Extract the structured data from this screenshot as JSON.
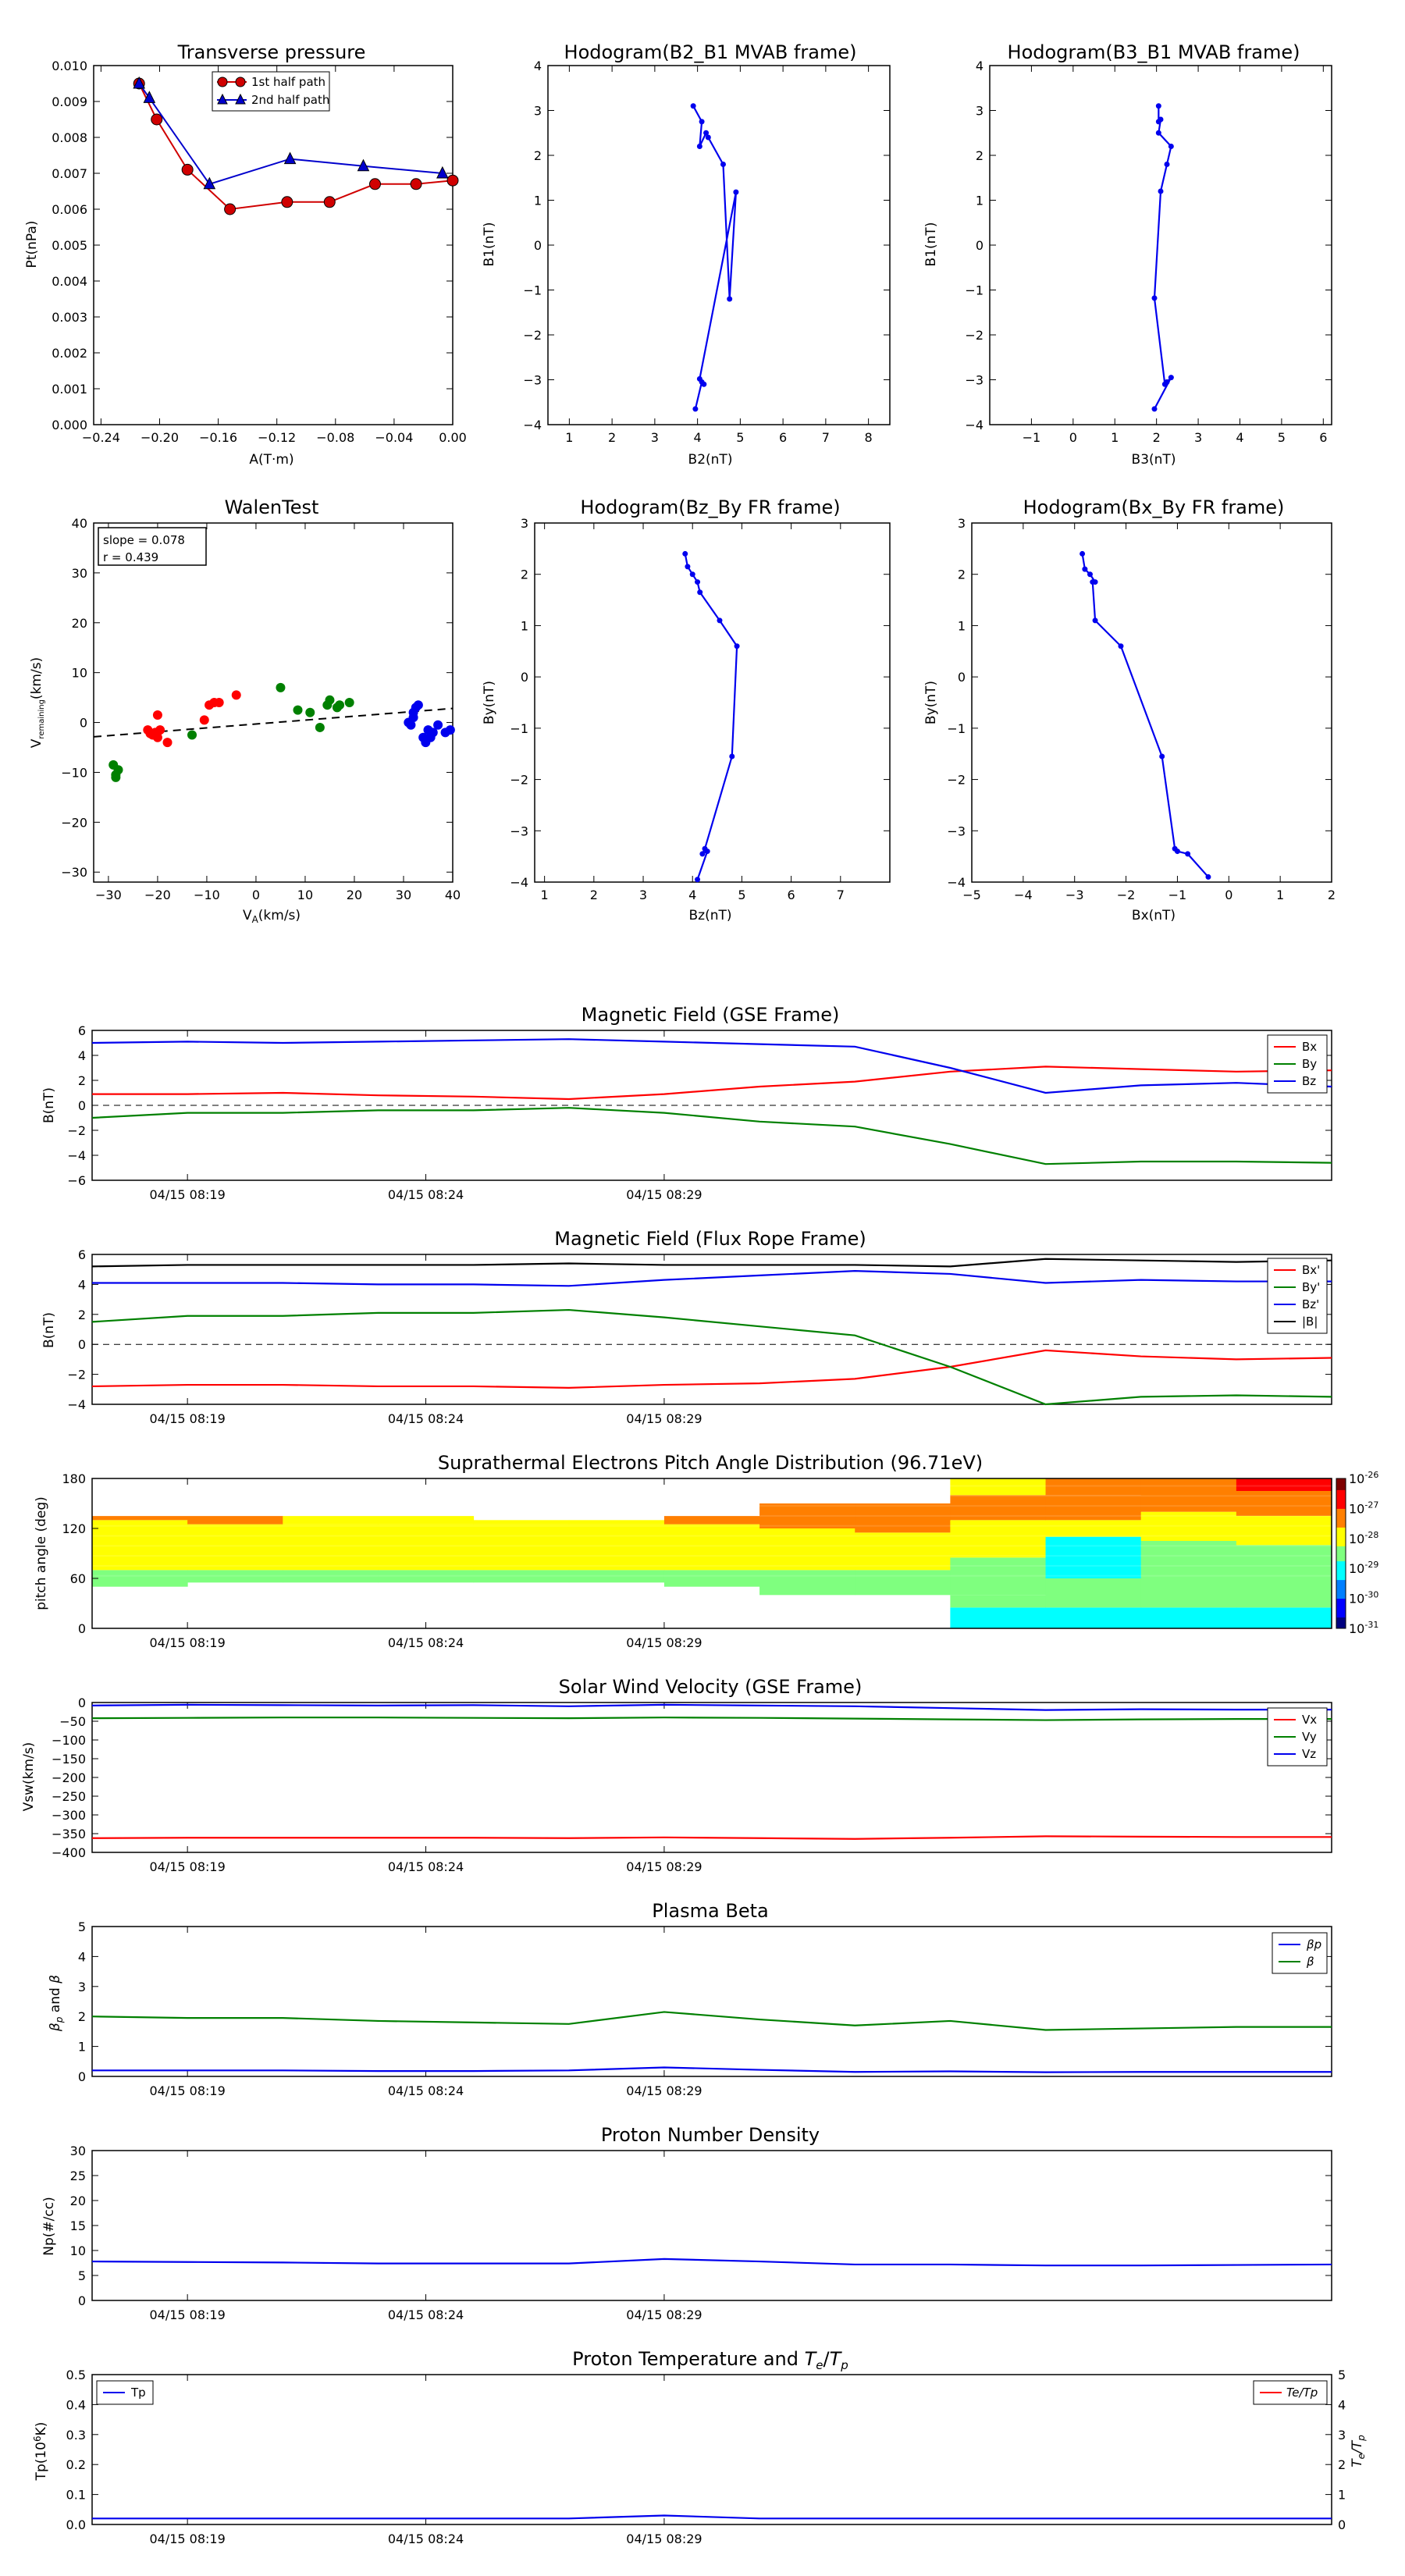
{
  "chart_data": [
    {
      "id": "pt",
      "type": "line",
      "title": "Transverse pressure",
      "xlabel": "A(T·m)",
      "ylabel": "Pt(nPa)",
      "xlim": [
        -0.245,
        0.0
      ],
      "ylim": [
        0.0,
        0.01
      ],
      "xticks": [
        -0.24,
        -0.2,
        -0.16,
        -0.12,
        -0.08,
        -0.04,
        0.0
      ],
      "xtick_labels": [
        "−0.24",
        "−0.20",
        "−0.16",
        "−0.12",
        "−0.08",
        "−0.04",
        "0.00"
      ],
      "yticks": [
        0,
        0.001,
        0.002,
        0.003,
        0.004,
        0.005,
        0.006,
        0.007,
        0.008,
        0.009,
        0.01
      ],
      "ytick_labels": [
        "0.000",
        "0.001",
        "0.002",
        "0.003",
        "0.004",
        "0.005",
        "0.006",
        "0.007",
        "0.008",
        "0.009",
        "0.010"
      ],
      "legend": "top-center",
      "series": [
        {
          "name": "1st half path",
          "color": "#d00000",
          "marker": "circle",
          "x": [
            -0.214,
            -0.202,
            -0.181,
            -0.152,
            -0.113,
            -0.084,
            -0.053,
            -0.025,
            0.0
          ],
          "y": [
            0.0095,
            0.0085,
            0.0071,
            0.006,
            0.0062,
            0.0062,
            0.0067,
            0.0067,
            0.0068
          ]
        },
        {
          "name": "2nd half path",
          "color": "#0000cc",
          "marker": "triangle",
          "x": [
            -0.214,
            -0.207,
            -0.166,
            -0.111,
            -0.061,
            -0.007
          ],
          "y": [
            0.0095,
            0.0091,
            0.0067,
            0.0074,
            0.0072,
            0.007
          ]
        }
      ]
    },
    {
      "id": "h1",
      "type": "line",
      "title": "Hodogram(B2_B1 MVAB frame)",
      "xlabel": "B2(nT)",
      "ylabel": "B1(nT)",
      "xlim": [
        0.5,
        8.5
      ],
      "ylim": [
        -4,
        4
      ],
      "xticks": [
        1,
        2,
        3,
        4,
        5,
        6,
        7,
        8
      ],
      "yticks": [
        -4,
        -3,
        -2,
        -1,
        0,
        1,
        2,
        3,
        4
      ],
      "series": [
        {
          "name": "",
          "color": "#0000ee",
          "x": [
            3.95,
            4.1,
            4.15,
            4.05,
            4.9,
            4.75,
            4.6,
            4.25,
            4.2,
            4.05,
            4.1,
            3.9
          ],
          "y": [
            -3.65,
            -3.05,
            -3.1,
            -2.98,
            1.18,
            -1.2,
            1.8,
            2.4,
            2.5,
            2.2,
            2.75,
            3.1
          ]
        }
      ]
    },
    {
      "id": "h2",
      "type": "line",
      "title": "Hodogram(B3_B1 MVAB frame)",
      "xlabel": "B3(nT)",
      "ylabel": "B1(nT)",
      "xlim": [
        -2,
        6.2
      ],
      "ylim": [
        -4,
        4
      ],
      "xticks": [
        -1,
        0,
        1,
        2,
        3,
        4,
        5,
        6
      ],
      "yticks": [
        -4,
        -3,
        -2,
        -1,
        0,
        1,
        2,
        3,
        4
      ],
      "series": [
        {
          "name": "",
          "color": "#0000ee",
          "x": [
            1.95,
            2.35,
            2.25,
            2.2,
            1.95,
            2.1,
            2.25,
            2.35,
            2.05,
            2.1,
            2.05,
            2.05
          ],
          "y": [
            -3.65,
            -2.95,
            -3.05,
            -3.1,
            -1.18,
            1.2,
            1.8,
            2.2,
            2.5,
            2.8,
            2.75,
            3.1
          ]
        }
      ]
    },
    {
      "id": "walen",
      "type": "scatter",
      "title": "WalenTest",
      "xlabel": "V_A(km/s)",
      "ylabel": "V_remaining(km/s)",
      "annotation": [
        "slope = 0.078",
        "r = 0.439"
      ],
      "xlim": [
        -33,
        40
      ],
      "ylim": [
        -32,
        40
      ],
      "xticks": [
        -30,
        -20,
        -10,
        0,
        10,
        20,
        30,
        40
      ],
      "yticks": [
        -30,
        -20,
        -10,
        0,
        10,
        20,
        30,
        40
      ],
      "fit": {
        "slope": 0.078,
        "intercept": -0.3,
        "color": "#000000"
      },
      "series": [
        {
          "name": "",
          "color": "#ff0000",
          "x": [
            -22,
            -21,
            -20.5,
            -20,
            -19.5,
            -21.5,
            -20,
            -18,
            -10.5,
            -9.5,
            -8.5,
            -7.5,
            -4
          ],
          "y": [
            -1.5,
            -2.5,
            -2,
            -3,
            -1.5,
            -2.2,
            1.5,
            -4,
            0.5,
            3.5,
            4,
            4,
            5.5
          ]
        },
        {
          "name": "",
          "color": "#008000",
          "x": [
            -29,
            -28.5,
            -28,
            -28.5,
            -13,
            5,
            8.5,
            11,
            13,
            14.5,
            15,
            16.5,
            17,
            19
          ],
          "y": [
            -8.5,
            -10.5,
            -9.5,
            -11,
            -2.5,
            7,
            2.5,
            2,
            -1,
            3.5,
            4.5,
            3,
            3.5,
            4
          ]
        },
        {
          "name": "",
          "color": "#0000ee",
          "x": [
            31,
            32,
            32.5,
            32,
            31.5,
            33,
            34,
            34.5,
            35,
            35.5,
            36,
            37,
            39.5,
            38.5
          ],
          "y": [
            0,
            1,
            3,
            2,
            -0.5,
            3.5,
            -3,
            -4,
            -1.5,
            -3,
            -2,
            -0.5,
            -1.5,
            -2
          ]
        }
      ]
    },
    {
      "id": "h3",
      "type": "line",
      "title": "Hodogram(Bz_By FR frame)",
      "xlabel": "Bz(nT)",
      "ylabel": "By(nT)",
      "xlim": [
        0.8,
        8
      ],
      "ylim": [
        -4,
        3
      ],
      "xticks": [
        1,
        2,
        3,
        4,
        5,
        6,
        7
      ],
      "yticks": [
        -4,
        -3,
        -2,
        -1,
        0,
        1,
        2,
        3
      ],
      "series": [
        {
          "name": "",
          "color": "#0000ee",
          "x": [
            4.1,
            4.3,
            4.2,
            4.25,
            4.8,
            4.9,
            4.55,
            4.15,
            4.1,
            4.0,
            3.9,
            3.85
          ],
          "y": [
            -3.95,
            -3.4,
            -3.45,
            -3.35,
            -1.55,
            0.6,
            1.1,
            1.65,
            1.85,
            2.0,
            2.15,
            2.4
          ]
        }
      ]
    },
    {
      "id": "h4",
      "type": "line",
      "title": "Hodogram(Bx_By FR frame)",
      "xlabel": "Bx(nT)",
      "ylabel": "By(nT)",
      "xlim": [
        -5,
        2
      ],
      "ylim": [
        -4,
        3
      ],
      "xticks": [
        -5,
        -4,
        -3,
        -2,
        -1,
        0,
        1,
        2
      ],
      "yticks": [
        -4,
        -3,
        -2,
        -1,
        0,
        1,
        2,
        3
      ],
      "series": [
        {
          "name": "",
          "color": "#0000ee",
          "x": [
            -0.4,
            -0.8,
            -1.0,
            -1.05,
            -1.3,
            -2.1,
            -2.6,
            -2.65,
            -2.6,
            -2.7,
            -2.8,
            -2.85
          ],
          "y": [
            -3.9,
            -3.45,
            -3.4,
            -3.35,
            -1.55,
            0.6,
            1.1,
            1.85,
            1.85,
            2.0,
            2.1,
            2.4
          ]
        }
      ]
    },
    {
      "id": "bgse",
      "type": "line",
      "title": "Magnetic Field (GSE Frame)",
      "ylabel": "B(nT)",
      "ylim": [
        -6,
        6
      ],
      "yticks": [
        -6,
        -4,
        -2,
        0,
        2,
        4,
        6
      ],
      "x_time_minutes": [
        0,
        2,
        4,
        6,
        8,
        10,
        12,
        14,
        16,
        18,
        20,
        22,
        24,
        26
      ],
      "xticks_min": [
        2,
        7,
        12
      ],
      "xtick_labels": [
        "04/15 08:19",
        "04/15 08:24",
        "04/15 08:29"
      ],
      "zero_line": true,
      "legend": "top-right",
      "series": [
        {
          "name": "Bx",
          "color": "#ff0000",
          "values": [
            0.9,
            0.9,
            1.0,
            0.8,
            0.7,
            0.5,
            0.9,
            1.5,
            1.9,
            2.7,
            3.1,
            2.9,
            2.7,
            2.8
          ]
        },
        {
          "name": "By",
          "color": "#008000",
          "values": [
            -1.0,
            -0.6,
            -0.6,
            -0.4,
            -0.4,
            -0.2,
            -0.6,
            -1.3,
            -1.7,
            -3.1,
            -4.7,
            -4.5,
            -4.5,
            -4.6
          ]
        },
        {
          "name": "Bz",
          "color": "#0000ee",
          "values": [
            5.0,
            5.1,
            5.0,
            5.1,
            5.2,
            5.3,
            5.1,
            4.9,
            4.7,
            3.0,
            1.0,
            1.6,
            1.8,
            1.5
          ]
        }
      ]
    },
    {
      "id": "bfr",
      "type": "line",
      "title": "Magnetic Field (Flux Rope Frame)",
      "ylabel": "B(nT)",
      "ylim": [
        -4,
        6
      ],
      "yticks": [
        -4,
        -2,
        0,
        2,
        4,
        6
      ],
      "x_time_minutes": [
        0,
        2,
        4,
        6,
        8,
        10,
        12,
        14,
        16,
        18,
        20,
        22,
        24,
        26
      ],
      "xticks_min": [
        2,
        7,
        12
      ],
      "xtick_labels": [
        "04/15 08:19",
        "04/15 08:24",
        "04/15 08:29"
      ],
      "zero_line": true,
      "legend": "top-right",
      "series": [
        {
          "name": "Bx'",
          "color": "#ff0000",
          "values": [
            -2.8,
            -2.7,
            -2.7,
            -2.8,
            -2.8,
            -2.9,
            -2.7,
            -2.6,
            -2.3,
            -1.5,
            -0.4,
            -0.8,
            -1.0,
            -0.9
          ]
        },
        {
          "name": "By'",
          "color": "#008000",
          "values": [
            1.5,
            1.9,
            1.9,
            2.1,
            2.1,
            2.3,
            1.8,
            1.2,
            0.6,
            -1.5,
            -4.0,
            -3.5,
            -3.4,
            -3.5
          ]
        },
        {
          "name": "Bz'",
          "color": "#0000ee",
          "values": [
            4.1,
            4.1,
            4.1,
            4.0,
            4.0,
            3.9,
            4.3,
            4.6,
            4.9,
            4.7,
            4.1,
            4.3,
            4.2,
            4.2
          ]
        },
        {
          "name": "|B|",
          "color": "#000000",
          "values": [
            5.2,
            5.3,
            5.3,
            5.3,
            5.3,
            5.4,
            5.3,
            5.3,
            5.3,
            5.2,
            5.7,
            5.6,
            5.5,
            5.6
          ]
        }
      ]
    },
    {
      "id": "pad",
      "type": "heatmap",
      "title": "Suprathermal Electrons Pitch Angle Distribution (96.71eV)",
      "ylabel": "pitch angle (deg)",
      "ylim": [
        0,
        180
      ],
      "yticks": [
        0,
        60,
        120,
        180
      ],
      "xticks_min": [
        2,
        7,
        12
      ],
      "xtick_labels": [
        "04/15 08:19",
        "04/15 08:24",
        "04/15 08:29"
      ],
      "colorbar_ticks": [
        "10-26",
        "10-27",
        "10-28",
        "10-29",
        "10-30",
        "10-31"
      ],
      "colorbar_log_range": [
        -31,
        -26
      ]
    },
    {
      "id": "vsw",
      "type": "line",
      "title": "Solar Wind Velocity (GSE Frame)",
      "ylabel": "Vsw(km/s)",
      "ylim": [
        -400,
        0
      ],
      "yticks": [
        -400,
        -350,
        -300,
        -250,
        -200,
        -150,
        -100,
        -50,
        0
      ],
      "x_time_minutes": [
        0,
        2,
        4,
        6,
        8,
        10,
        12,
        14,
        16,
        18,
        20,
        22,
        24,
        26
      ],
      "xticks_min": [
        2,
        7,
        12
      ],
      "xtick_labels": [
        "04/15 08:19",
        "04/15 08:24",
        "04/15 08:29"
      ],
      "legend": "top-right",
      "series": [
        {
          "name": "Vx",
          "color": "#ff0000",
          "values": [
            -362,
            -361,
            -361,
            -361,
            -361,
            -362,
            -360,
            -362,
            -364,
            -361,
            -357,
            -358,
            -359,
            -359
          ]
        },
        {
          "name": "Vy",
          "color": "#008000",
          "values": [
            -42,
            -41,
            -40,
            -40,
            -41,
            -42,
            -40,
            -41,
            -43,
            -45,
            -47,
            -45,
            -44,
            -44
          ]
        },
        {
          "name": "Vz",
          "color": "#0000ee",
          "values": [
            -8,
            -6,
            -7,
            -8,
            -7,
            -10,
            -6,
            -8,
            -10,
            -15,
            -20,
            -18,
            -19,
            -19
          ]
        }
      ]
    },
    {
      "id": "beta",
      "type": "line",
      "title": "Plasma Beta",
      "ylabel": "βp and β",
      "ylim": [
        0,
        5
      ],
      "yticks": [
        0,
        1,
        2,
        3,
        4,
        5
      ],
      "x_time_minutes": [
        0,
        2,
        4,
        6,
        8,
        10,
        12,
        14,
        16,
        18,
        20,
        22,
        24,
        26
      ],
      "xticks_min": [
        2,
        7,
        12
      ],
      "xtick_labels": [
        "04/15 08:19",
        "04/15 08:24",
        "04/15 08:29"
      ],
      "legend": "top-right",
      "series": [
        {
          "name": "βp",
          "color": "#0000ee",
          "values": [
            0.2,
            0.2,
            0.2,
            0.18,
            0.18,
            0.2,
            0.3,
            0.22,
            0.15,
            0.17,
            0.14,
            0.15,
            0.15,
            0.15
          ]
        },
        {
          "name": "β",
          "color": "#008000",
          "values": [
            2.0,
            1.95,
            1.95,
            1.85,
            1.8,
            1.75,
            2.15,
            1.9,
            1.7,
            1.85,
            1.55,
            1.6,
            1.65,
            1.65
          ]
        }
      ]
    },
    {
      "id": "np",
      "type": "line",
      "title": "Proton Number Density",
      "ylabel": "Np(#/cc)",
      "ylim": [
        0,
        30
      ],
      "yticks": [
        0,
        5,
        10,
        15,
        20,
        25,
        30
      ],
      "x_time_minutes": [
        0,
        2,
        4,
        6,
        8,
        10,
        12,
        14,
        16,
        18,
        20,
        22,
        24,
        26
      ],
      "xticks_min": [
        2,
        7,
        12
      ],
      "xtick_labels": [
        "04/15 08:19",
        "04/15 08:24",
        "04/15 08:29"
      ],
      "series": [
        {
          "name": "",
          "color": "#0000ee",
          "values": [
            7.8,
            7.7,
            7.6,
            7.4,
            7.4,
            7.4,
            8.3,
            7.8,
            7.2,
            7.2,
            7.0,
            7.0,
            7.1,
            7.2
          ]
        }
      ]
    },
    {
      "id": "tp",
      "type": "line",
      "title": "Proton Temperature and Te/Tp",
      "ylabel": "Tp(10^6K)",
      "ylabel_right": "Te/Tp",
      "ylim": [
        0,
        0.5
      ],
      "yticks": [
        0,
        0.1,
        0.2,
        0.3,
        0.4,
        0.5
      ],
      "ylim_right": [
        0,
        5
      ],
      "yticks_right": [
        0,
        1,
        2,
        3,
        4,
        5
      ],
      "x_time_minutes": [
        0,
        2,
        4,
        6,
        8,
        10,
        12,
        14,
        16,
        18,
        20,
        22,
        24,
        26
      ],
      "xticks_min": [
        2,
        7,
        12
      ],
      "xtick_labels": [
        "04/15 08:19",
        "04/15 08:24",
        "04/15 08:29"
      ],
      "legend": "top-left",
      "series": [
        {
          "name": "Tp",
          "color": "#0000ee",
          "values": [
            0.02,
            0.02,
            0.02,
            0.02,
            0.02,
            0.02,
            0.03,
            0.02,
            0.02,
            0.02,
            0.02,
            0.02,
            0.02,
            0.02
          ]
        },
        {
          "name": "Te/Tp",
          "color": "#ff0000",
          "axis": "right",
          "values": []
        }
      ]
    }
  ]
}
